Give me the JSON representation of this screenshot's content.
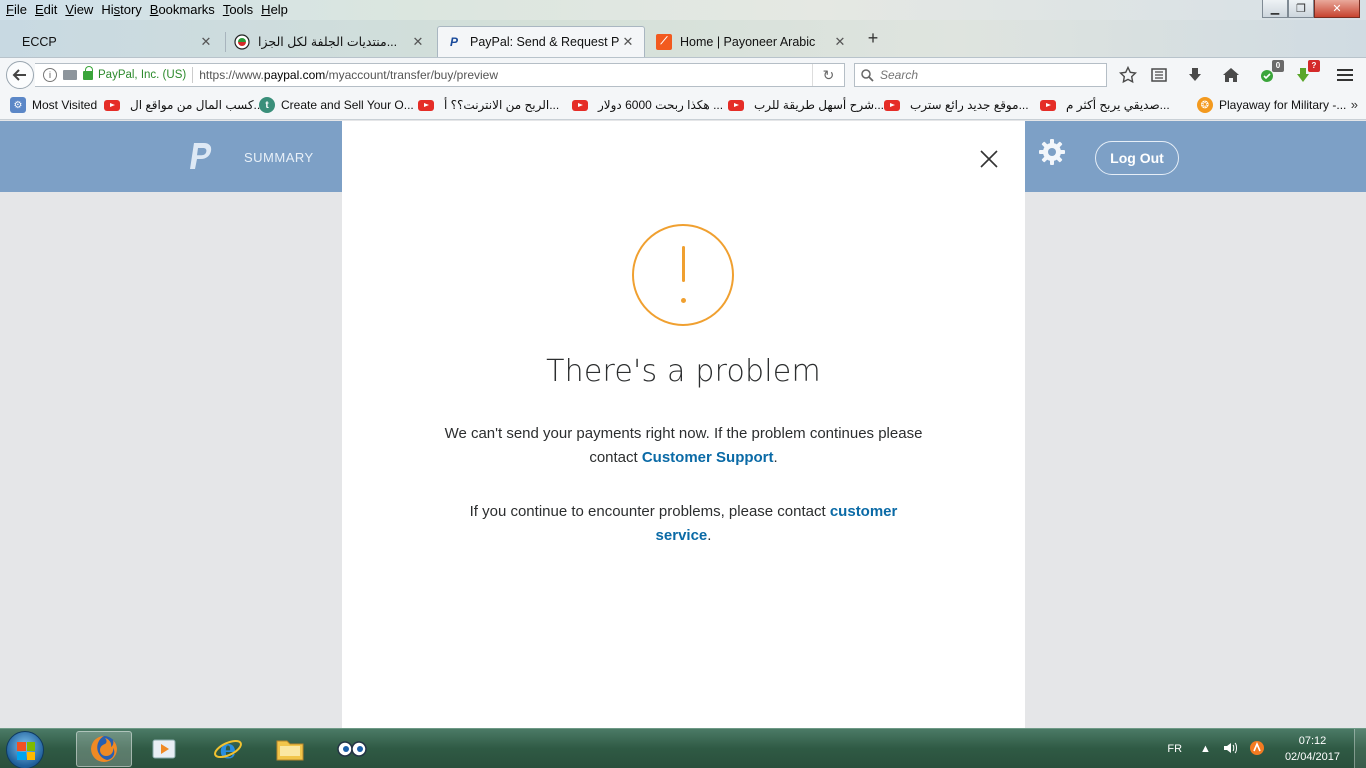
{
  "menu": {
    "items": [
      {
        "acc": "F",
        "rest": "ile"
      },
      {
        "acc": "E",
        "rest": "dit"
      },
      {
        "acc": "V",
        "rest": "iew"
      },
      {
        "pre": "Hi",
        "acc": "s",
        "rest": "tory"
      },
      {
        "acc": "B",
        "rest": "ookmarks"
      },
      {
        "acc": "T",
        "rest": "ools"
      },
      {
        "acc": "H",
        "rest": "elp"
      }
    ]
  },
  "window": {
    "minimize": "▁",
    "maximize": "❐",
    "close": "✕"
  },
  "tabs": [
    {
      "title": "ECCP",
      "close": "✕"
    },
    {
      "title": "منتديات الجلفة لكل الجزا...",
      "close": "✕"
    },
    {
      "title": "PayPal: Send & Request Pa...",
      "close": "✕"
    },
    {
      "title": "Home | Payoneer Arabic",
      "close": "✕"
    }
  ],
  "new_tab_label": "+",
  "navbar": {
    "site_identity": "PayPal, Inc. (US)",
    "url_prefix": "https://www.",
    "url_domain": "paypal.com",
    "url_path": "/myaccount/transfer/buy/preview",
    "search_placeholder": "Search",
    "badge_count_1": "0",
    "badge_count_2": "?"
  },
  "bookmarks": [
    {
      "label": "Most Visited"
    },
    {
      "label": "كسب المال من مواقع ال..."
    },
    {
      "label": "Create and Sell Your O..."
    },
    {
      "label": "الربح من الانترنت؟؟ أ..."
    },
    {
      "label": "هكذا ربحت 6000 دولار ..."
    },
    {
      "label": "شرح أسهل طريقة للرب..."
    },
    {
      "label": "موقع جديد رائع سترب..."
    },
    {
      "label": "صديقي يربح أكثر م..."
    },
    {
      "label": "Playaway for Military -..."
    }
  ],
  "bookmarks_more": "»",
  "paypal": {
    "nav_summary": "SUMMARY",
    "logout": "Log Out",
    "modal": {
      "heading": "There's a problem",
      "para1_text": "We can't send your payments right now. If the problem continues please contact ",
      "para1_link": "Customer Support",
      "para1_end": ".",
      "para2_text": "If you continue to encounter problems, please contact ",
      "para2_link": "customer service",
      "para2_end": "."
    }
  },
  "taskbar": {
    "language": "FR",
    "time": "07:12",
    "date": "02/04/2017"
  },
  "colors": {
    "paypal_header": "#7da0c6",
    "alert_orange": "#f0a030",
    "link_blue": "#0a6aa6"
  }
}
